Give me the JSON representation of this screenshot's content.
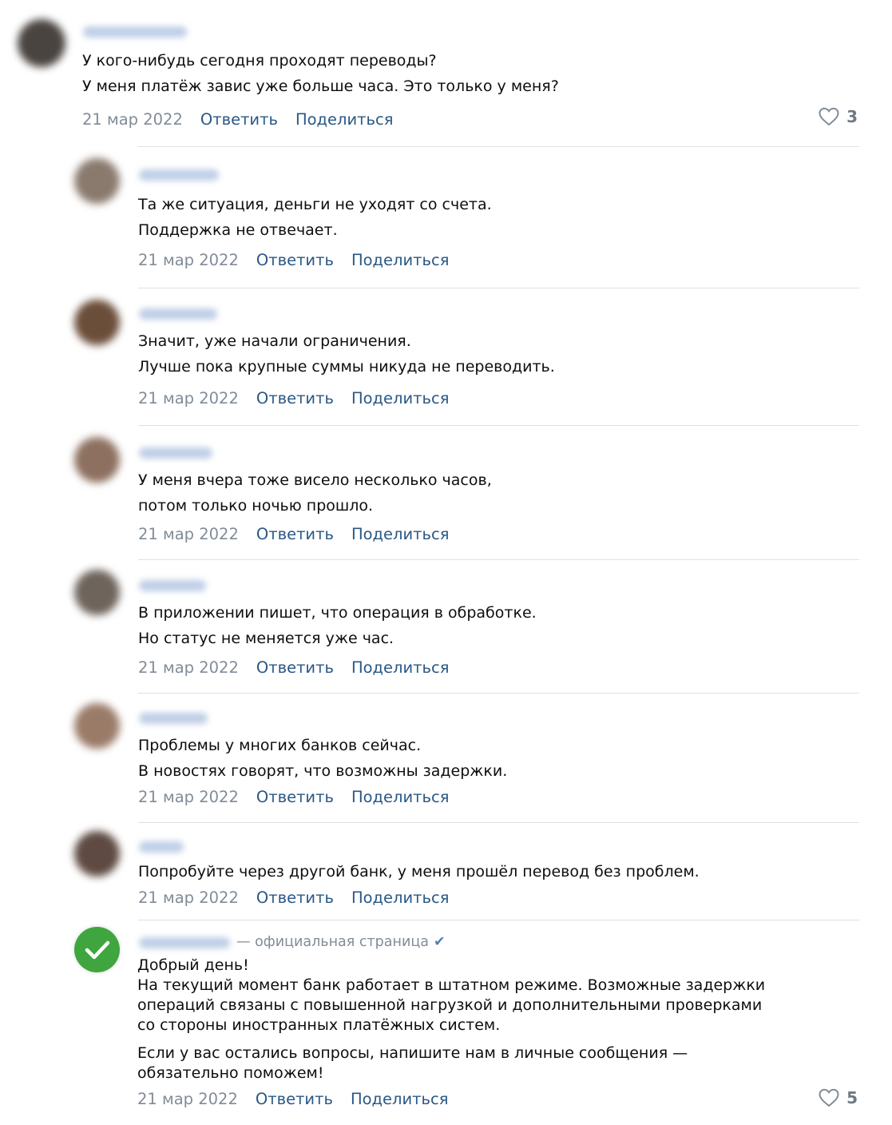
{
  "reply_label": "Ответить",
  "share_label": "Поделиться",
  "comments": [
    {
      "lines": [
        "У кого-нибудь сегодня проходят переводы?",
        "У меня платёж завис уже больше часа. Это только у меня?"
      ],
      "date": "21 мар 2022",
      "likes": "3",
      "avatar_color": "#4a4440"
    },
    {
      "lines": [
        "Та же ситуация, деньги не уходят со счета.",
        "Поддержка не отвечает."
      ],
      "date": "21 мар 2022",
      "avatar_color": "#8a7a6e"
    },
    {
      "lines": [
        "Значит, уже начали ограничения.",
        "Лучше пока крупные суммы никуда не переводить."
      ],
      "date": "21 мар 2022",
      "avatar_color": "#6b4e3a"
    },
    {
      "lines": [
        "У меня вчера тоже висело несколько часов,",
        "потом только ночью прошло."
      ],
      "date": "21 мар 2022",
      "avatar_color": "#8d7060"
    },
    {
      "lines": [
        "В приложении пишет, что операция в обработке.",
        "Но статус не меняется уже час."
      ],
      "date": "21 мар 2022",
      "avatar_color": "#6e645c"
    },
    {
      "lines": [
        "Проблемы у многих банков сейчас.",
        "В новостях говорят, что возможны задержки."
      ],
      "date": "21 мар 2022",
      "avatar_color": "#9a7b68"
    },
    {
      "lines": [
        "Попробуйте через другой банк, у меня прошёл перевод без проблем."
      ],
      "date": "21 мар 2022",
      "avatar_color": "#5e4a42"
    }
  ],
  "official": {
    "label": "— официальная страница",
    "greeting": "Добрый день!",
    "paragraph1": [
      "На текущий момент банк работает в штатном режиме. Возможные задержки",
      "операций связаны с повышенной нагрузкой и дополнительными проверками",
      "со стороны иностранных платёжных систем."
    ],
    "paragraph2": [
      "Если у вас остались вопросы, напишите нам в личные сообщения —",
      "обязательно поможем!"
    ],
    "date": "21 мар 2022",
    "likes": "5",
    "badge_color": "#3fa63f"
  }
}
